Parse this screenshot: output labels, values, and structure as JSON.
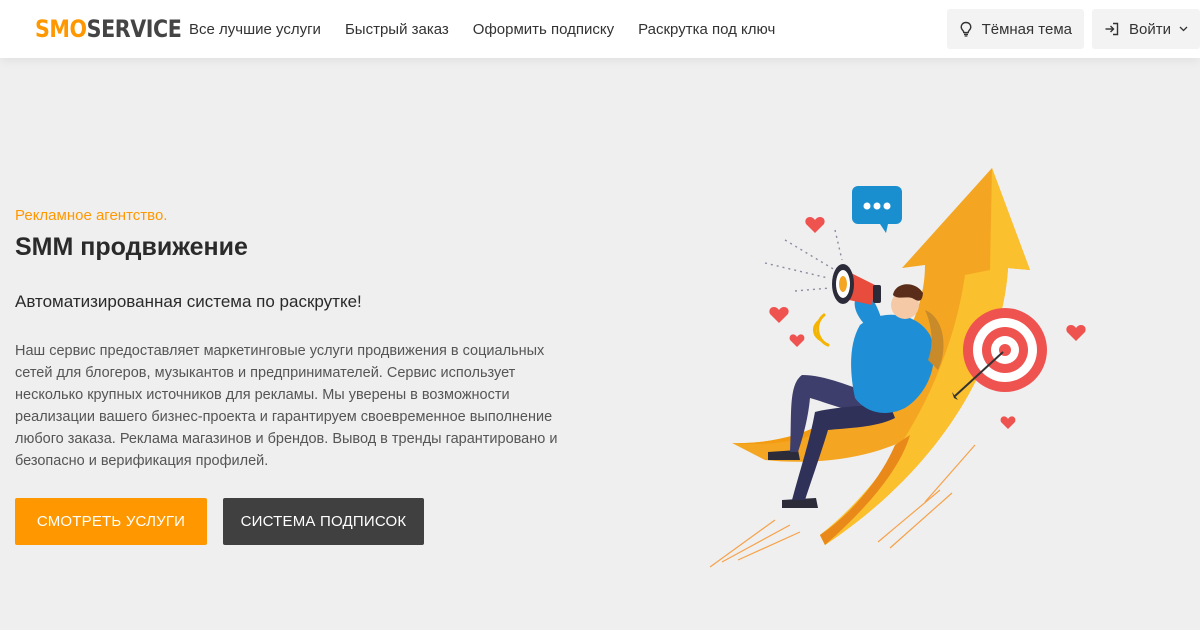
{
  "header": {
    "logo_part1": "SMO",
    "logo_part2": "SERVICE",
    "nav": [
      {
        "label": "Все лучшие услуги"
      },
      {
        "label": "Быстрый заказ"
      },
      {
        "label": "Оформить подписку"
      },
      {
        "label": "Раскрутка под ключ"
      }
    ],
    "theme_label": "Тёмная тема",
    "login_label": "Войти"
  },
  "hero": {
    "eyebrow": "Рекламное агентство.",
    "title": "SMM продвижение",
    "subtitle": "Автоматизированная система по раскрутке!",
    "description": "Наш сервис предоставляет маркетинговые услуги продвижения в социальных сетей для блогеров, музыкантов и предпринимателей. Сервис использует несколько крупных источников для рекламы. Мы уверены в возможности реализации вашего бизнес-проекта и гарантируем своевременное выполнение любого заказа. Реклама магазинов и брендов. Вывод в тренды гарантировано и безопасно и верификация профилей.",
    "primary_button": "СМОТРЕТЬ УСЛУГИ",
    "secondary_button": "СИСТЕМА ПОДПИСОК"
  },
  "colors": {
    "accent": "#ff9800",
    "dark_button": "#404040",
    "background": "#efefef"
  },
  "icons": {
    "theme": "lightbulb-icon",
    "login": "sign-in-icon",
    "dropdown": "chevron-down-icon"
  }
}
